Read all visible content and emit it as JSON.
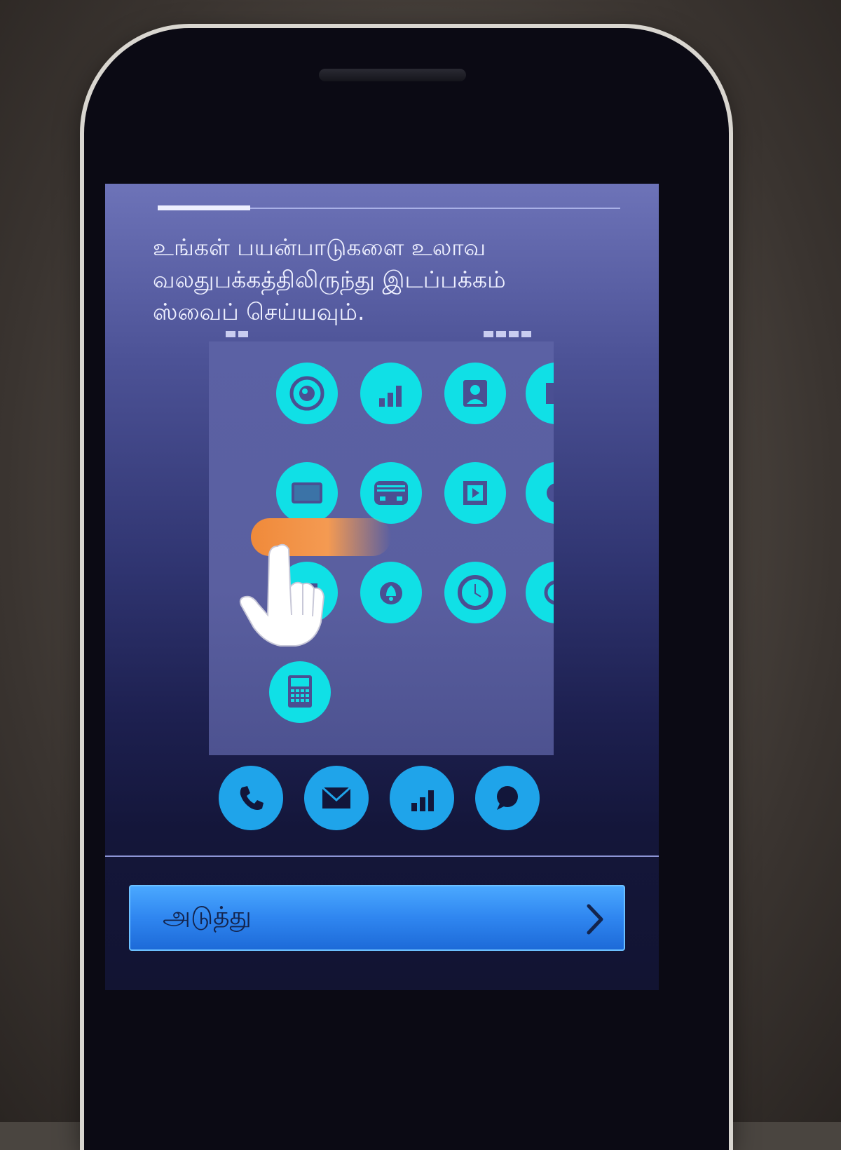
{
  "tutorial": {
    "instruction": "உங்கள் பயன்பாடுகளை உலாவ வலதுபக்கத்திலிருந்து இடப்பக்கம் ஸ்வைப் செய்யவும்.",
    "progress_fraction": 0.2
  },
  "illustration": {
    "apps": [
      {
        "icon": "camera-icon"
      },
      {
        "icon": "signal-icon"
      },
      {
        "icon": "contacts-icon"
      },
      {
        "icon": "calendar-icon"
      },
      {
        "icon": "messages-icon"
      },
      {
        "icon": "radio-icon"
      },
      {
        "icon": "video-icon"
      },
      {
        "icon": "browser-icon"
      },
      {
        "icon": "gallery-icon"
      },
      {
        "icon": "alarm-icon"
      },
      {
        "icon": "clock-icon"
      },
      {
        "icon": "settings-icon"
      },
      {
        "icon": "calculator-icon"
      }
    ],
    "dock": [
      {
        "icon": "phone-icon"
      },
      {
        "icon": "mail-icon"
      },
      {
        "icon": "signal-icon"
      },
      {
        "icon": "chat-icon"
      }
    ],
    "accent_color": "#10e0e6",
    "dock_color": "#1fa4ea",
    "swipe_color": "#f08a3a"
  },
  "footer": {
    "next_label": "அடுத்து"
  }
}
